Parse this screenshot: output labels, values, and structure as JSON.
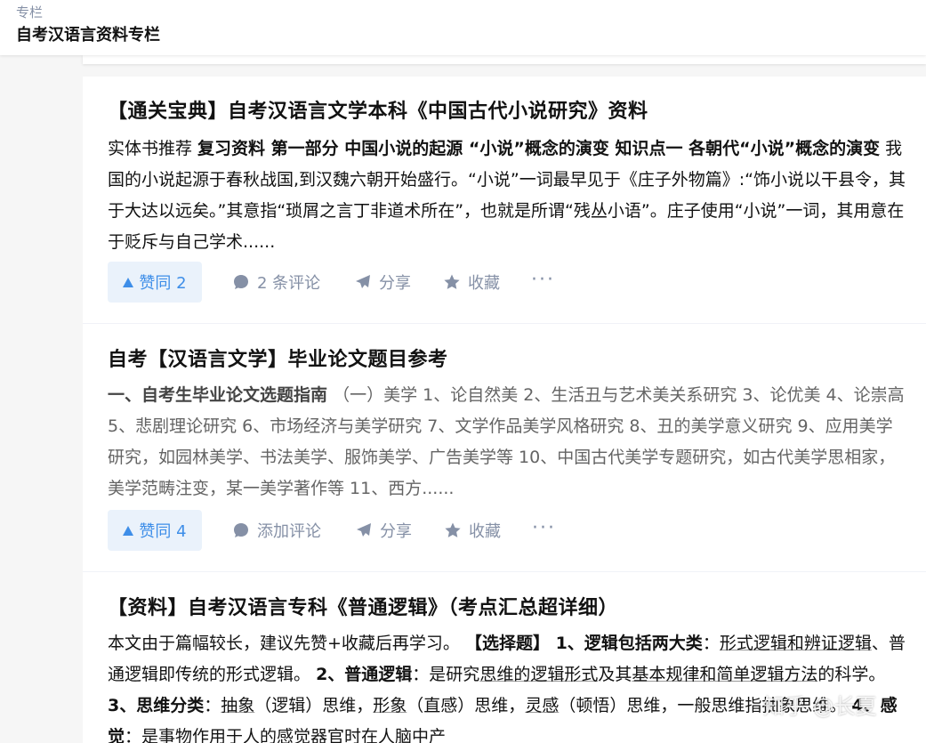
{
  "header": {
    "small_label": "专栏",
    "column_title": "自考汉语言资料专栏"
  },
  "items": [
    {
      "title": "【通关宝典】自考汉语言文学本科《中国古代小说研究》资料",
      "excerpt": {
        "lead": "实体书推荐 ",
        "bold": "复习资料 第一部分 中国小说的起源 “小说”概念的演变 知识点一 各朝代“小说”概念的演变",
        "rest": " 我国的小说起源于春秋战国,到汉魏六朝开始盛行。“小说”一词最早见于《庄子外物篇》:“饰小说以干县令，其于大达以远矣。”其意指“琐屑之言丁非道术所在”，也就是所谓“残丛小语”。庄子使用“小说”一词，其用意在于贬斥与自己学术......"
      },
      "vote_label": "赞同 2",
      "comment_label": "2 条评论",
      "share_label": "分享",
      "favorite_label": "收藏",
      "more_label": "···"
    },
    {
      "title": "自考【汉语言文学】毕业论文题目参考",
      "excerpt": {
        "bold": "一、自考生毕业论文选题指南",
        "rest": "（一）美学 1、论自然美 2、生活丑与艺术美关系研究 3、论优美 4、论崇高 5、悲剧理论研究 6、市场经济与美学研究 7、文学作品美学风格研究 8、丑的美学意义研究 9、应用美学研究，如园林美学、书法美学、服饰美学、广告美学等 10、中国古代美学专题研究，如古代美学思相家，美学范畴注变，某一美学著作等 11、西方......"
      },
      "vote_label": "赞同 4",
      "comment_label": "添加评论",
      "share_label": "分享",
      "favorite_label": "收藏",
      "more_label": "···"
    },
    {
      "title": "【资料】自考汉语言专科《普通逻辑》（考点汇总超详细）",
      "excerpt": {
        "p1": "本文由于篇幅较长，建议先赞+收藏后再学习。",
        "b1": "【选择题】 1、逻辑包括两大类",
        "p2": "：",
        "u1": "形式逻辑和辨证逻辑",
        "p3": "、普通逻辑即传统的形式逻辑。",
        "b2": "2、普通逻辑",
        "p4": "：是研究",
        "u2": "思维的逻辑形式",
        "p5": "及其",
        "u3": "基本规律和简单逻辑方法",
        "p6": "的科学。",
        "b3": "3、思维分类",
        "p7": "：",
        "u4": "抽象",
        "p8": "（逻辑）思维，",
        "u5": "形象",
        "p9": "（直感）思维，",
        "u6": "灵感",
        "p10": "（顿悟）思维，一般思维指抽象思维。",
        "b4": "4、感觉",
        "p11": "：是事物作用于人的感觉器官时在人脑中产"
      }
    }
  ],
  "watermark": "知乎 @长夏",
  "colors": {
    "accent": "#3e8ee8",
    "vote_bg": "#eaf2fb",
    "meta_gray": "#8590a6"
  }
}
